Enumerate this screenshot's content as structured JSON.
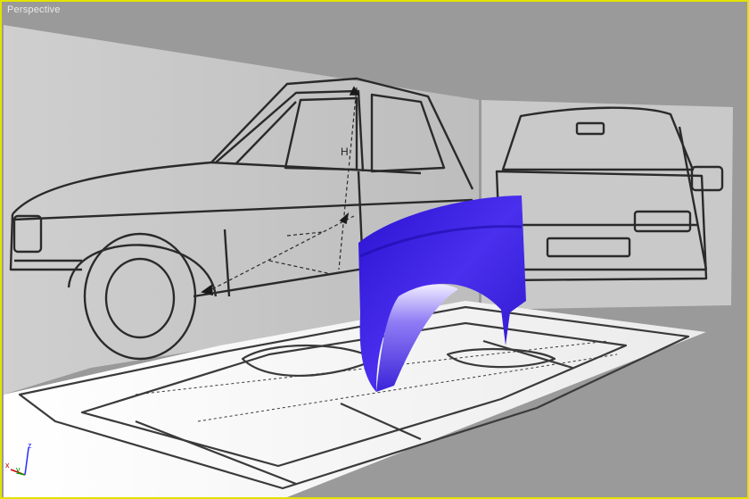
{
  "viewport": {
    "label": "Perspective",
    "active_border_color": "#e2e200",
    "background_color": "#9a9a9a"
  },
  "scene": {
    "side_blueprint": {
      "plane_color": "#c4c4c4",
      "line_color": "#2a2a2a"
    },
    "front_blueprint": {
      "plane_color": "#cacaca",
      "line_color": "#2a2a2a"
    },
    "top_blueprint": {
      "plane_color": "#f5f5f5",
      "line_color": "#3a3a3a"
    },
    "fender_mesh": {
      "color": "#3a1fe0",
      "highlight": "#d8d0ff"
    }
  },
  "axis_gizmo": {
    "z": "z",
    "y": "y",
    "x": "x"
  }
}
